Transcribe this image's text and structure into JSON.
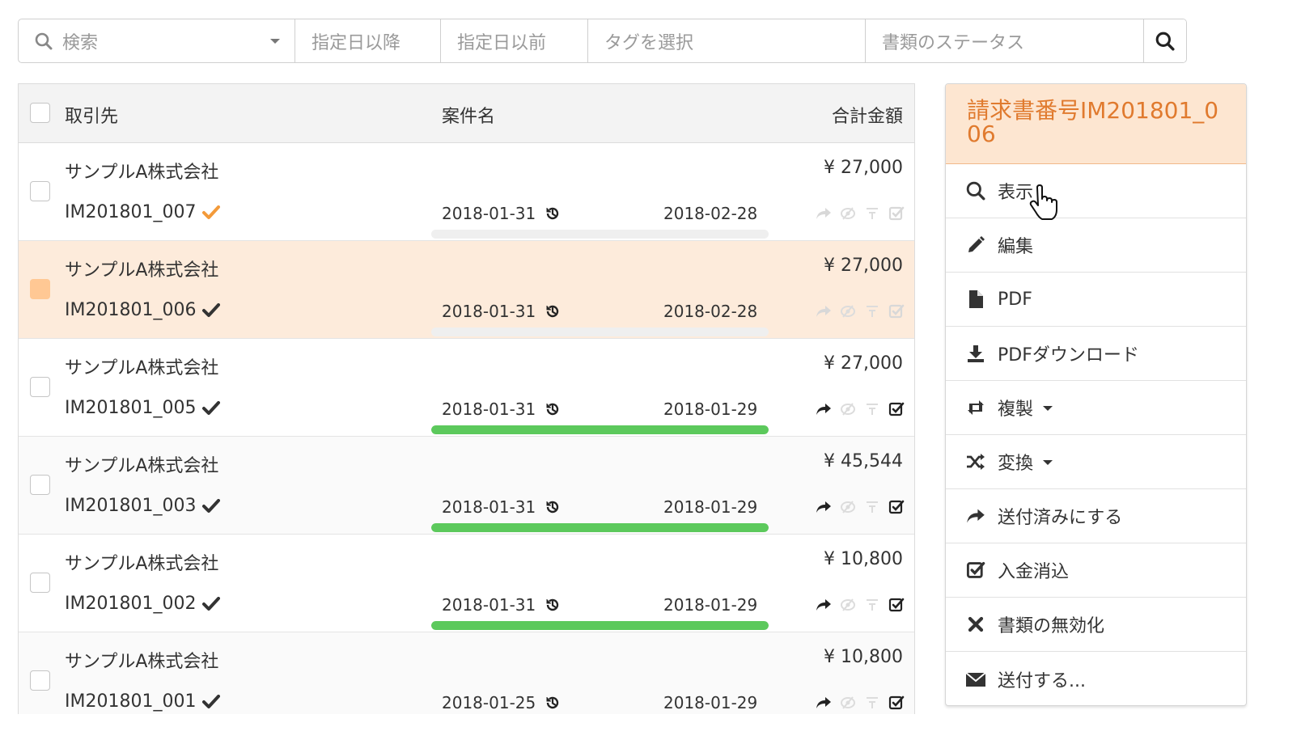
{
  "filters": {
    "search_placeholder": "検索",
    "date_after_placeholder": "指定日以降",
    "date_before_placeholder": "指定日以前",
    "tags_placeholder": "タグを選択",
    "status_placeholder": "書類のステータス"
  },
  "table": {
    "headers": {
      "party": "取引先",
      "case": "案件名",
      "total": "合計金額"
    },
    "rows": [
      {
        "company": "サンプルA株式会社",
        "number": "IM201801_007",
        "amount": "¥ 27,000",
        "date1": "2018-01-31",
        "date2": "2018-02-28",
        "progress": 0,
        "check_color": "#f39a3a",
        "sent_active": false,
        "paid_active": false
      },
      {
        "company": "サンプルA株式会社",
        "number": "IM201801_006",
        "amount": "¥ 27,000",
        "date1": "2018-01-31",
        "date2": "2018-02-28",
        "progress": 0,
        "check_color": "#333333",
        "sent_active": false,
        "paid_active": false
      },
      {
        "company": "サンプルA株式会社",
        "number": "IM201801_005",
        "amount": "¥ 27,000",
        "date1": "2018-01-31",
        "date2": "2018-01-29",
        "progress": 1,
        "check_color": "#333333",
        "sent_active": true,
        "paid_active": true
      },
      {
        "company": "サンプルA株式会社",
        "number": "IM201801_003",
        "amount": "¥ 45,544",
        "date1": "2018-01-31",
        "date2": "2018-01-29",
        "progress": 1,
        "check_color": "#333333",
        "sent_active": true,
        "paid_active": true
      },
      {
        "company": "サンプルA株式会社",
        "number": "IM201801_002",
        "amount": "¥ 10,800",
        "date1": "2018-01-31",
        "date2": "2018-01-29",
        "progress": 1,
        "check_color": "#333333",
        "sent_active": true,
        "paid_active": true
      },
      {
        "company": "サンプルA株式会社",
        "number": "IM201801_001",
        "amount": "¥ 10,800",
        "date1": "2018-01-25",
        "date2": "2018-01-29",
        "progress": 1,
        "check_color": "#333333",
        "sent_active": true,
        "paid_active": true
      }
    ],
    "selected_row_index": 1
  },
  "side_menu": {
    "title": "請求書番号IM201801_006",
    "items": [
      {
        "label": "表示",
        "icon": "search-icon"
      },
      {
        "label": "編集",
        "icon": "pencil-icon"
      },
      {
        "label": "PDF",
        "icon": "file-icon"
      },
      {
        "label": "PDFダウンロード",
        "icon": "download-icon"
      },
      {
        "label": "複製",
        "icon": "retweet-icon",
        "dropdown": true
      },
      {
        "label": "変換",
        "icon": "shuffle-icon",
        "dropdown": true
      },
      {
        "label": "送付済みにする",
        "icon": "share-icon"
      },
      {
        "label": "入金消込",
        "icon": "check-square-icon"
      },
      {
        "label": "書類の無効化",
        "icon": "x-icon"
      },
      {
        "label": "送付する...",
        "icon": "envelope-icon"
      }
    ]
  },
  "colors": {
    "accent": "#e07a2e",
    "selected_row": "#fdebdb",
    "progress_fill": "#5cc95c",
    "header_bg": "#fde6d1"
  }
}
